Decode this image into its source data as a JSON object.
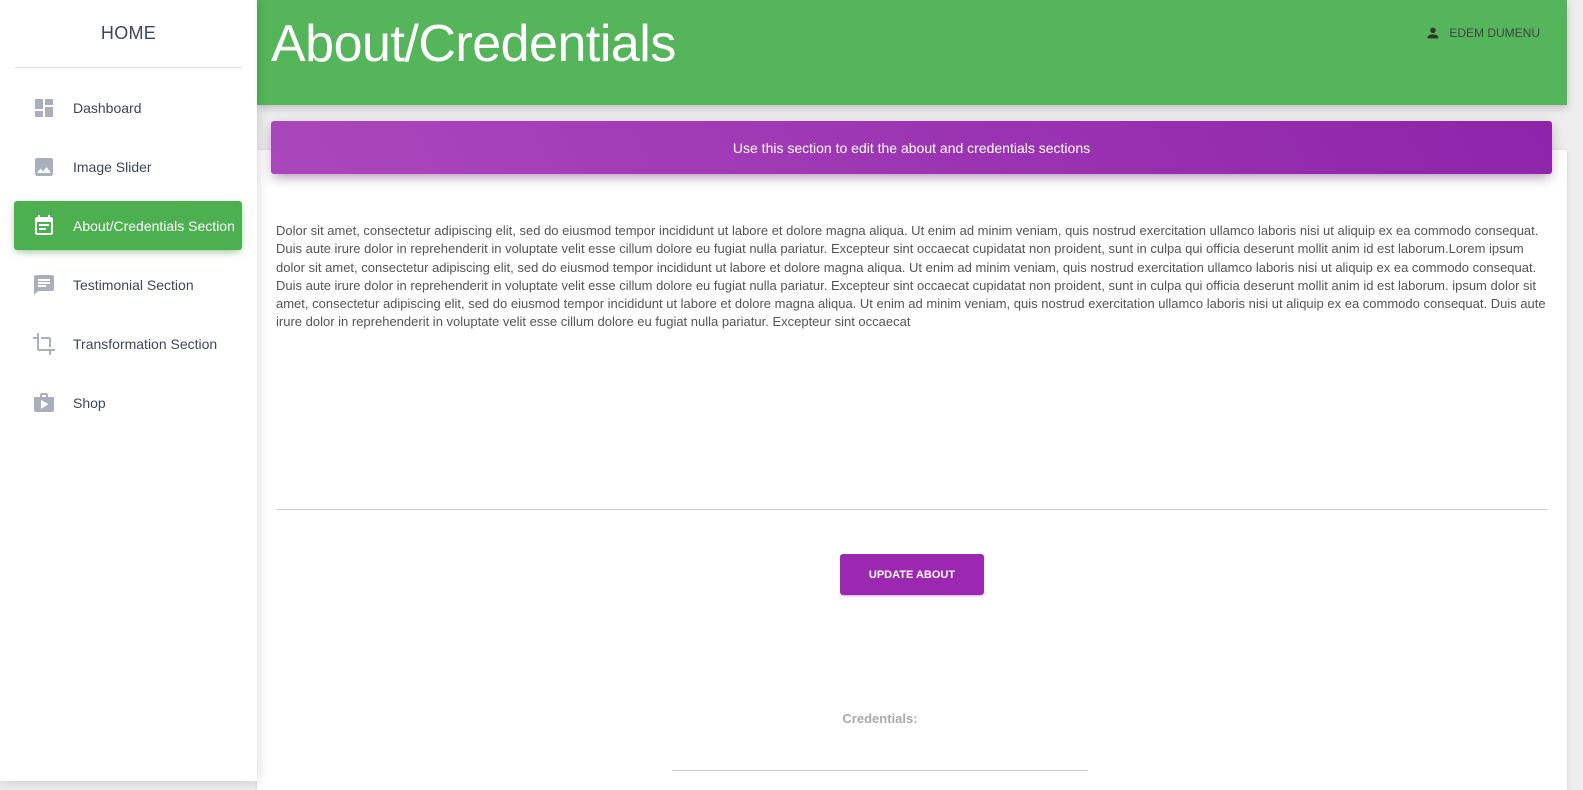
{
  "sidebar": {
    "brand": "HOME",
    "items": [
      {
        "label": "Dashboard",
        "icon": "dashboard-icon",
        "active": false
      },
      {
        "label": "Image Slider",
        "icon": "image-icon",
        "active": false
      },
      {
        "label": "About/Credentials Section",
        "icon": "event-note-icon",
        "active": true
      },
      {
        "label": "Testimonial Section",
        "icon": "chat-icon",
        "active": false
      },
      {
        "label": "Transformation Section",
        "icon": "crop-icon",
        "active": false
      },
      {
        "label": "Shop",
        "icon": "shop-icon",
        "active": false
      }
    ]
  },
  "header": {
    "title": "About/Credentials",
    "user_name": "EDEM DUMENU",
    "user_icon": "person-icon"
  },
  "card": {
    "banner_text": "Use this section to edit the about and credentials sections",
    "about_text": "Dolor sit amet, consectetur adipiscing elit, sed do eiusmod tempor incididunt ut labore et dolore magna aliqua. Ut enim ad minim veniam, quis nostrud exercitation ullamco laboris nisi ut aliquip ex ea commodo consequat. Duis aute irure dolor in reprehenderit in voluptate velit esse cillum dolore eu fugiat nulla pariatur. Excepteur sint occaecat cupidatat non proident, sunt in culpa qui officia deserunt mollit anim id est laborum.Lorem ipsum dolor sit amet, consectetur adipiscing elit, sed do eiusmod tempor incididunt ut labore et dolore magna aliqua. Ut enim ad minim veniam, quis nostrud exercitation ullamco laboris nisi ut aliquip ex ea commodo consequat. Duis aute irure dolor in reprehenderit in voluptate velit esse cillum dolore eu fugiat nulla pariatur. Excepteur sint occaecat cupidatat non proident, sunt in culpa qui officia deserunt mollit anim id est laborum. ipsum dolor sit amet, consectetur adipiscing elit, sed do eiusmod tempor incididunt ut labore et dolore magna aliqua. Ut enim ad minim veniam, quis nostrud exercitation ullamco laboris nisi ut aliquip ex ea commodo consequat. Duis aute irure dolor in reprehenderit in voluptate velit esse cillum dolore eu fugiat nulla pariatur. Excepteur sint occaecat",
    "update_button": "UPDATE ABOUT",
    "credentials_label": "Credentials:"
  },
  "colors": {
    "header_green": "#55b55a",
    "active_green": "#4caf50",
    "accent_purple": "#9c27b0"
  }
}
